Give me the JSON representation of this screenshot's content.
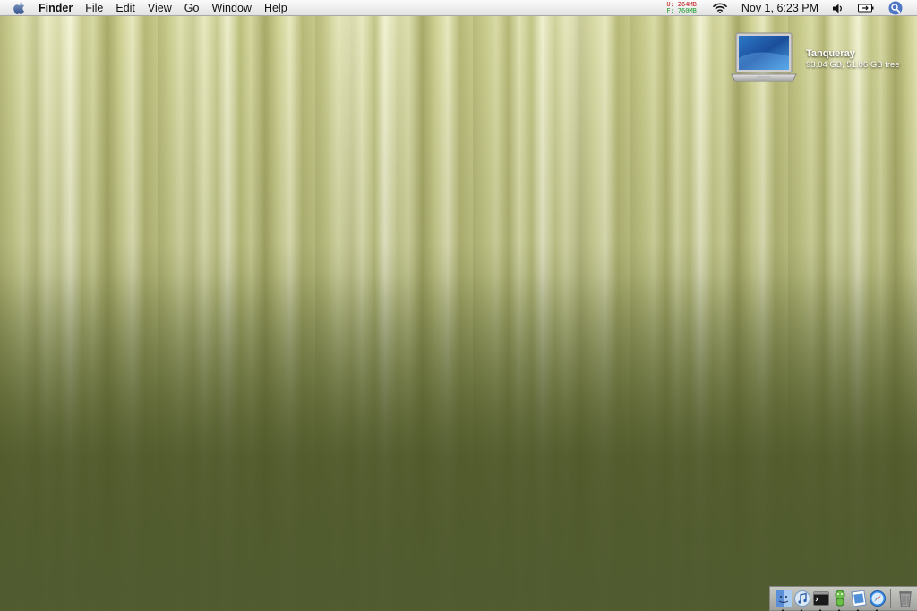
{
  "menubar": {
    "app_name": "Finder",
    "menus": [
      "File",
      "Edit",
      "View",
      "Go",
      "Window",
      "Help"
    ],
    "memory": {
      "used_label": "U:",
      "used_value": "264MB",
      "free_label": "F:",
      "free_value": "760MB"
    },
    "clock": "Nov 1, 6:23 PM"
  },
  "desktop": {
    "disk": {
      "name": "Tanqueray",
      "info": "93.04 GB, 51.86 GB free"
    }
  },
  "dock": {
    "items": [
      "finder",
      "itunes",
      "terminal",
      "adium",
      "preview",
      "safari",
      "trash"
    ]
  },
  "colors": {
    "wallpaper_top": "#c9cc8c",
    "wallpaper_bottom": "#56612d",
    "mem_used": "#c0181a",
    "mem_free": "#1e9b2a"
  }
}
